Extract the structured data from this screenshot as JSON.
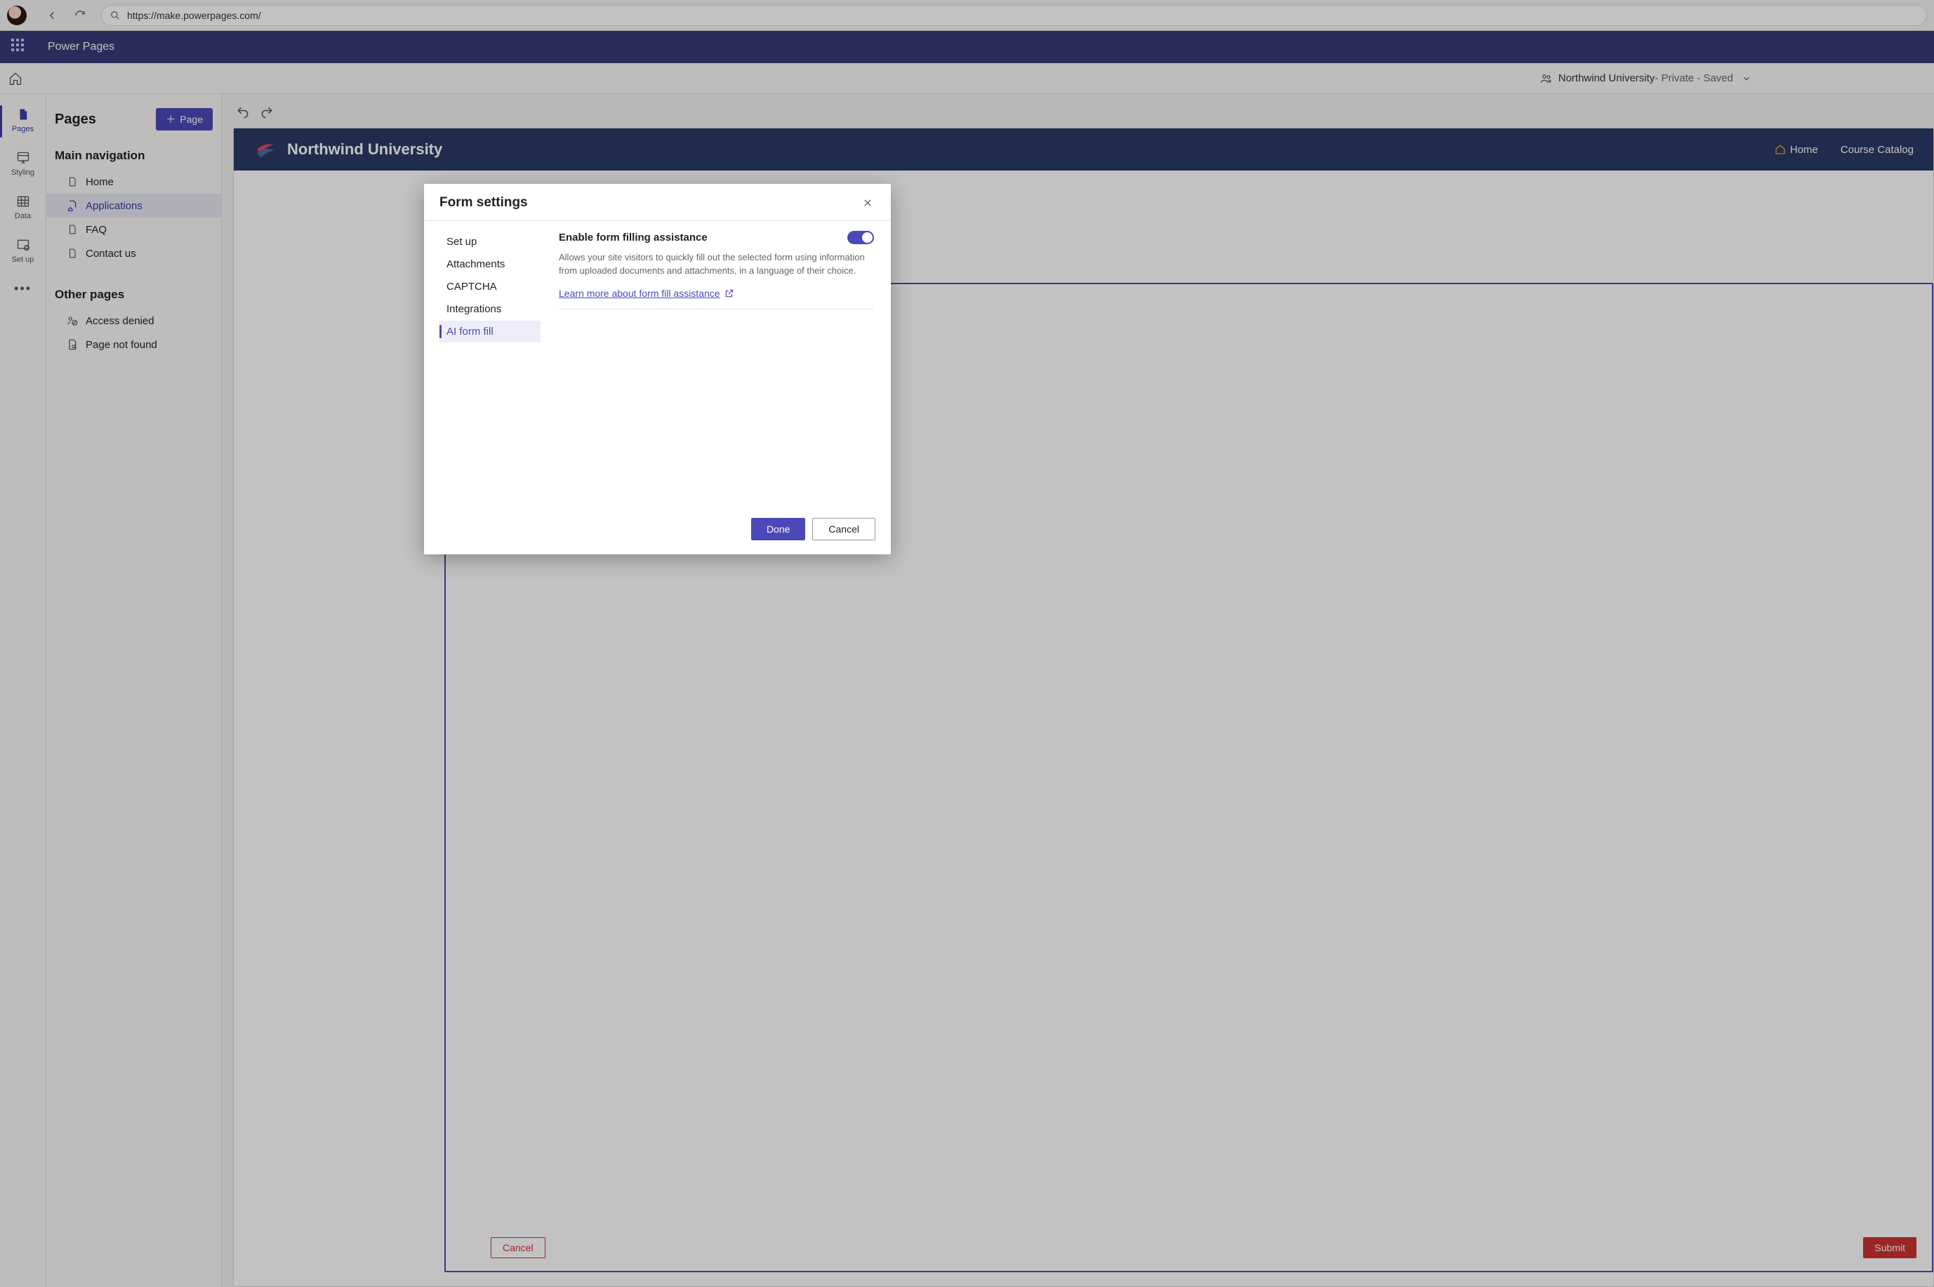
{
  "browser": {
    "url": "https://make.powerpages.com/"
  },
  "app": {
    "title": "Power Pages"
  },
  "breadcrumb": {
    "site_name": "Northwind University",
    "status": " - Private - Saved"
  },
  "left_rail": {
    "pages": "Pages",
    "styling": "Styling",
    "data": "Data",
    "setup": "Set up"
  },
  "side_panel": {
    "heading": "Pages",
    "add_button": "Page",
    "section_main": "Main navigation",
    "main_items": {
      "home": "Home",
      "applications": "Applications",
      "faq": "FAQ",
      "contact": "Contact us"
    },
    "section_other": "Other pages",
    "other_items": {
      "access_denied": "Access denied",
      "not_found": "Page not found"
    }
  },
  "canvas": {
    "site_title": "Northwind University",
    "nav_home": "Home",
    "nav_catalog": "Course Catalog",
    "form_cancel": "Cancel",
    "form_submit": "Submit"
  },
  "dialog": {
    "title": "Form settings",
    "tabs": {
      "setup": "Set up",
      "attachments": "Attachments",
      "captcha": "CAPTCHA",
      "integrations": "Integrations",
      "ai_form_fill": "AI form fill"
    },
    "pane": {
      "toggle_label": "Enable form filling assistance",
      "description": "Allows your site visitors to quickly fill out the selected form using information from uploaded documents and attachments, in a language of their choice.",
      "link_text": "Learn more about form fill assistance"
    },
    "done": "Done",
    "cancel": "Cancel"
  }
}
